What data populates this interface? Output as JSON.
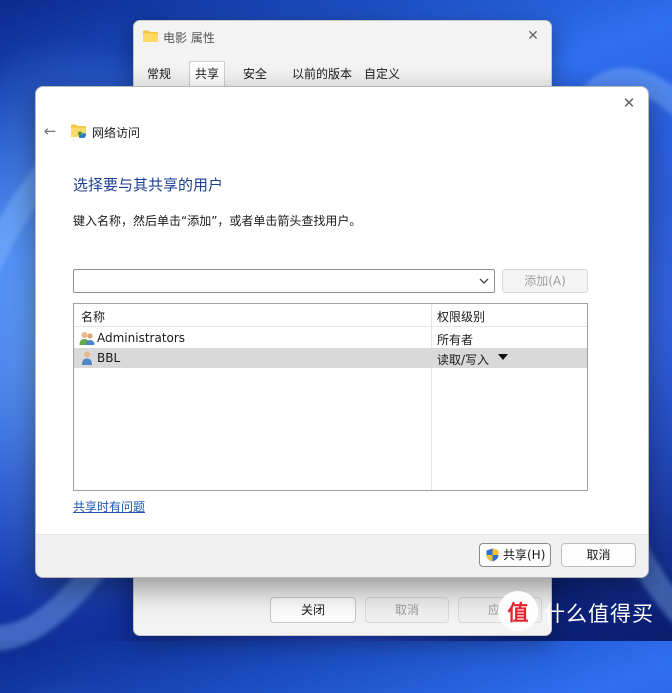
{
  "background_window": {
    "title": "电影 属性",
    "tabs": [
      {
        "label": "常规",
        "active": false
      },
      {
        "label": "共享",
        "active": true
      },
      {
        "label": "安全",
        "active": false
      },
      {
        "label": "以前的版本",
        "active": false
      },
      {
        "label": "自定义",
        "active": false
      }
    ],
    "buttons": {
      "close": "关闭",
      "cancel": "取消",
      "apply": "应用"
    }
  },
  "dialog": {
    "heading": "网络访问",
    "main_title": "选择要与其共享的用户",
    "instruction": "键入名称，然后单击“添加”，或者单击箭头查找用户。",
    "name_input": {
      "value": "",
      "placeholder": ""
    },
    "add_button": "添加(A)",
    "list": {
      "columns": {
        "name": "名称",
        "permission": "权限级别"
      },
      "rows": [
        {
          "name": "Administrators",
          "permission": "所有者",
          "icon": "user-group-icon",
          "selected": false
        },
        {
          "name": "BBL",
          "permission": "读取/写入",
          "icon": "user-icon",
          "selected": true
        }
      ]
    },
    "trouble_link": "共享时有问题",
    "share_button": "共享(H)",
    "cancel_button": "取消"
  },
  "watermark": {
    "logo_char": "值",
    "text": "什么值得买"
  },
  "colors": {
    "accent_title": "#1c3f94",
    "link": "#1d56b3",
    "selected_row": "#d9d9d9"
  }
}
